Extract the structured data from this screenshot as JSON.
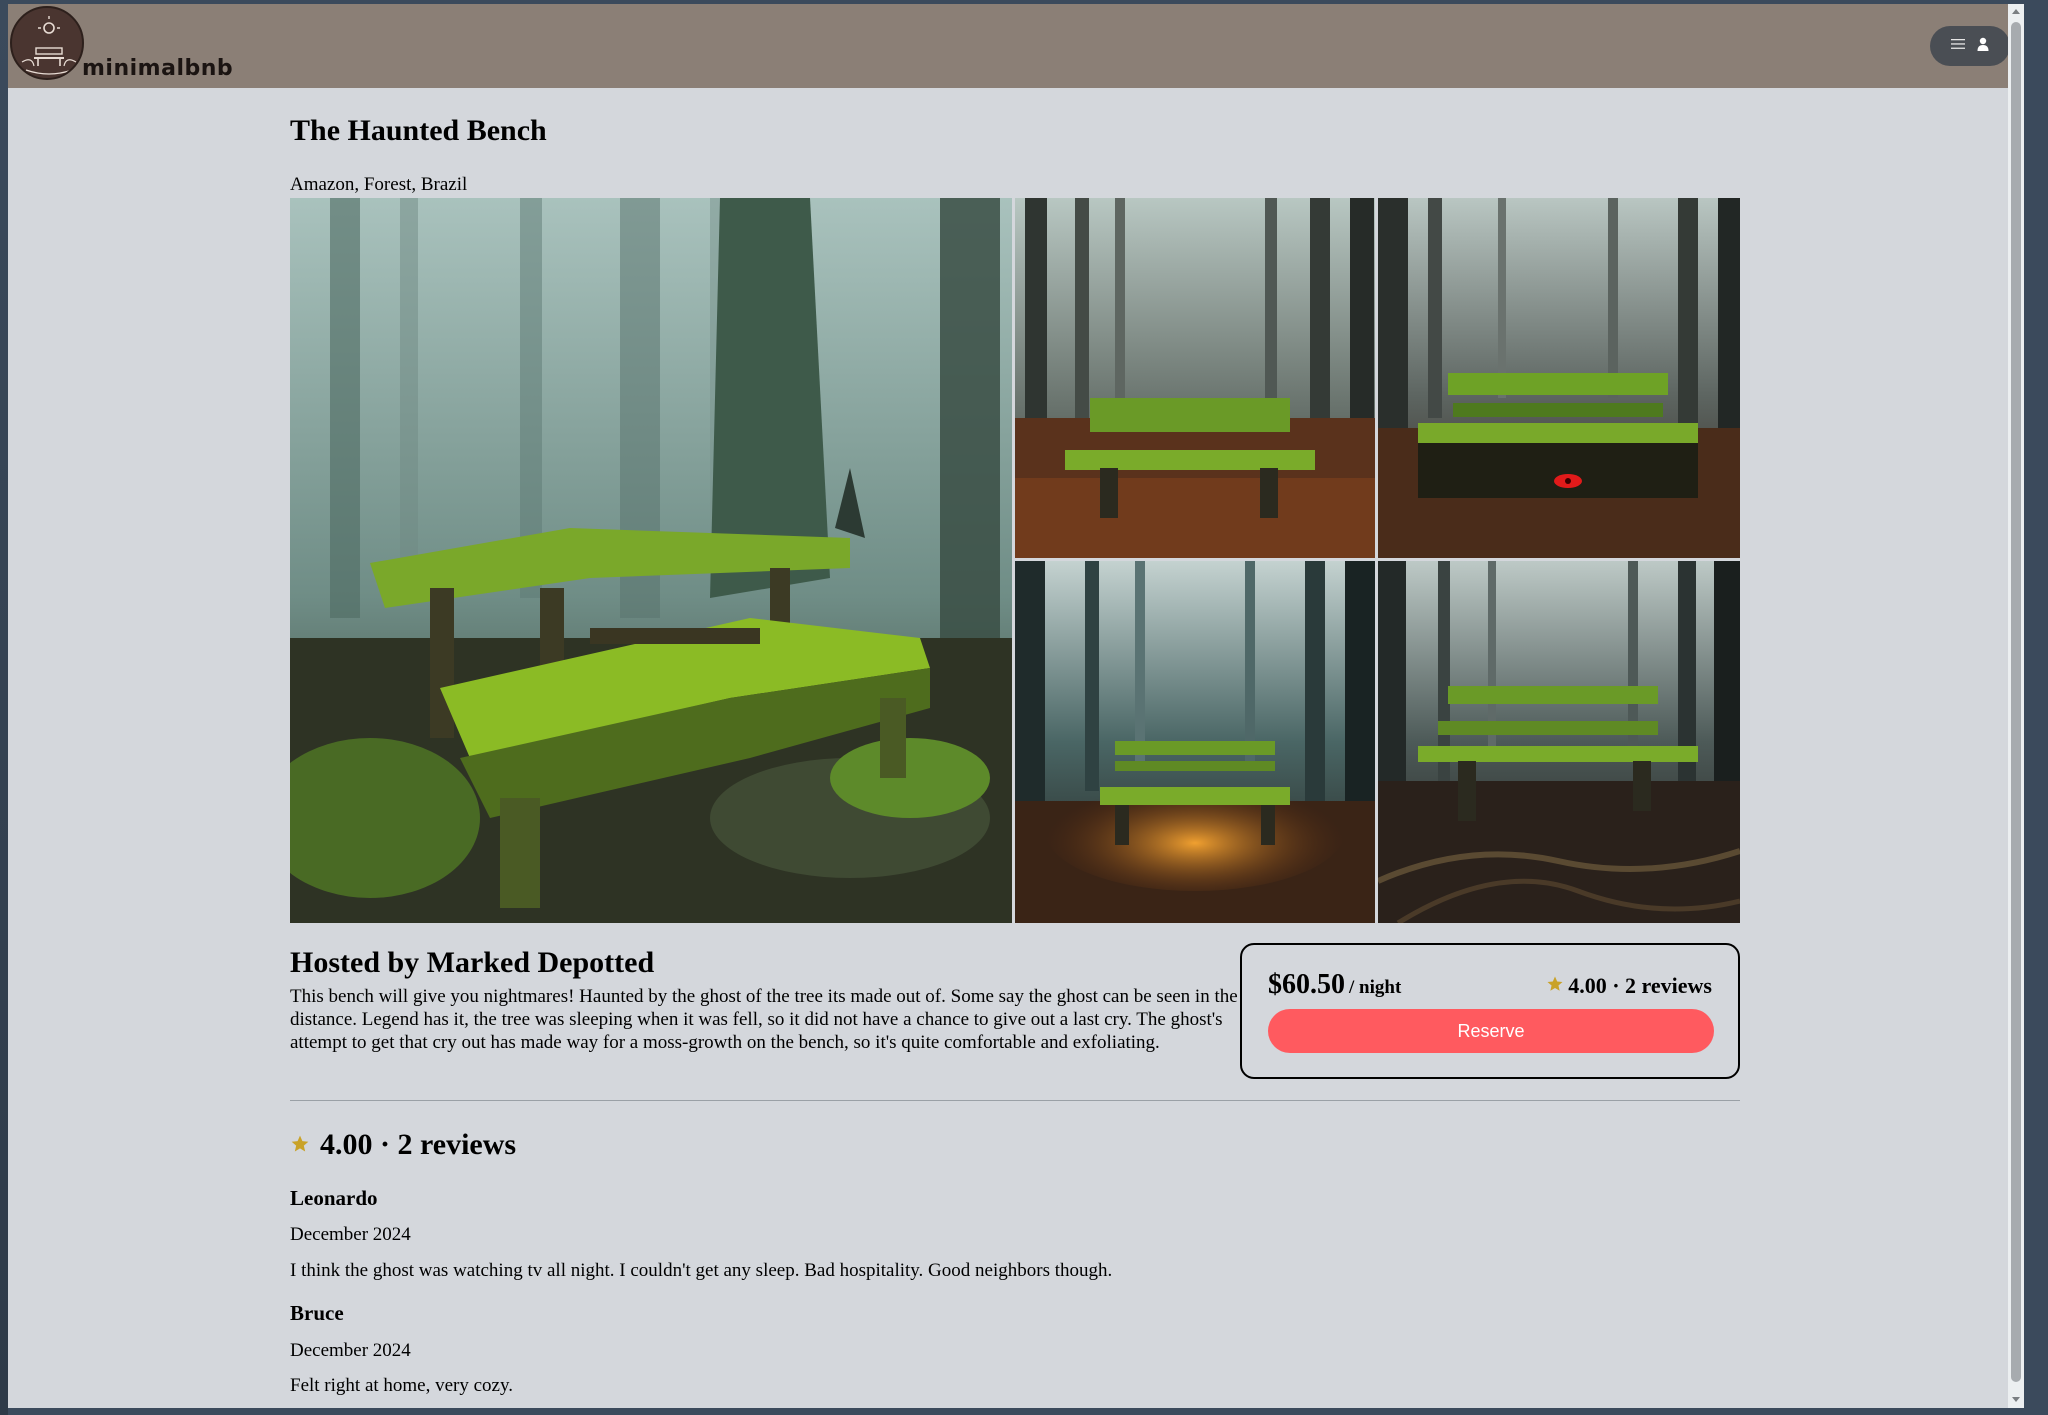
{
  "app": {
    "logo_text": "minimalbnb"
  },
  "listing": {
    "title": "The Haunted Bench",
    "location": "Amazon, Forest, Brazil",
    "host": "Hosted by Marked Depotted",
    "description": "This bench will give you nightmares! Haunted by the ghost of the tree its made out of. Some say the ghost can be seen in the distance. Legend has it, the tree was sleeping when it was fell, so it did not have a chance to give out a last cry. The ghost's attempt to get that cry out has made way for a moss-growth on the bench, so it's quite comfortable and exfoliating.",
    "photos": [
      "mossy-bench-forest-main",
      "mossy-bench-leaves",
      "bench-red-eye",
      "bench-glowing-leaves",
      "bench-roots"
    ]
  },
  "booking": {
    "price": "$60.50",
    "per_night": "/ night",
    "rating_summary": "4.00 · 2 reviews",
    "reserve_label": "Reserve"
  },
  "reviews": {
    "summary": "4.00 · 2 reviews",
    "items": [
      {
        "name": "Leonardo",
        "date": "December 2024",
        "text": "I think the ghost was watching tv all night. I couldn't get any sleep. Bad hospitality. Good neighbors though."
      },
      {
        "name": "Bruce",
        "date": "December 2024",
        "text": "Felt right at home, very cozy."
      }
    ]
  },
  "colors": {
    "accent": "#ff5a5f",
    "star": "#c9a227",
    "topbar": "#8b7f76",
    "background": "#d4d7dc"
  },
  "icons": [
    "logo-icon",
    "menu-icon",
    "user-icon",
    "star-icon"
  ]
}
